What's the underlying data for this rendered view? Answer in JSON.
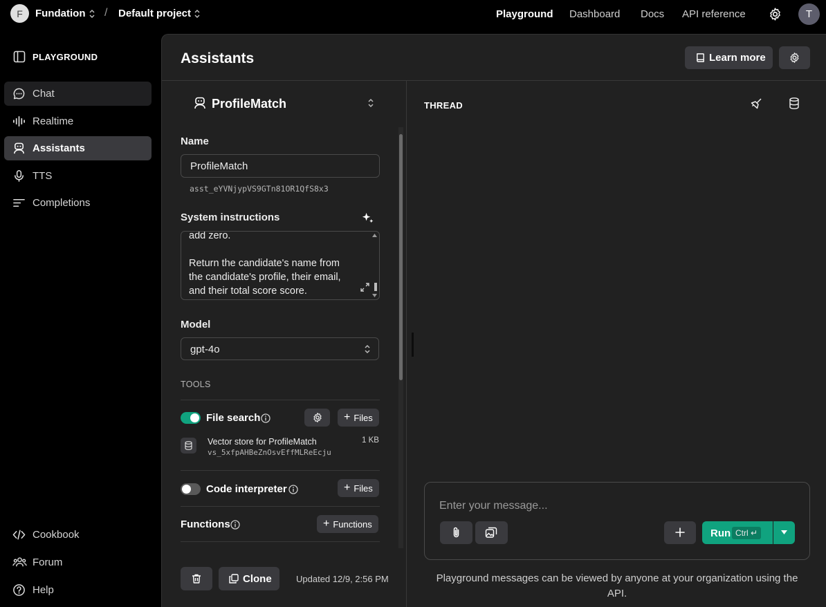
{
  "topbar": {
    "org_initial": "F",
    "org_name": "Fundation",
    "separator": "/",
    "project_name": "Default project",
    "nav": [
      {
        "label": "Playground",
        "active": true
      },
      {
        "label": "Dashboard",
        "active": false
      },
      {
        "label": "Docs",
        "active": false
      },
      {
        "label": "API reference",
        "active": false
      }
    ],
    "user_initial": "T"
  },
  "sidebar": {
    "header": "PLAYGROUND",
    "items": [
      {
        "label": "Chat",
        "icon": "chat-bubble-icon"
      },
      {
        "label": "Realtime",
        "icon": "audio-wave-icon"
      },
      {
        "label": "Assistants",
        "icon": "robot-icon",
        "active": true
      },
      {
        "label": "TTS",
        "icon": "microphone-icon"
      },
      {
        "label": "Completions",
        "icon": "text-lines-icon"
      }
    ],
    "footer": [
      {
        "label": "Cookbook",
        "icon": "code-icon"
      },
      {
        "label": "Forum",
        "icon": "people-icon"
      },
      {
        "label": "Help",
        "icon": "help-circle-icon"
      }
    ]
  },
  "main": {
    "title": "Assistants",
    "learn_more": "Learn more"
  },
  "assistant": {
    "selected": "ProfileMatch",
    "name_label": "Name",
    "name_value": "ProfileMatch",
    "id": "asst_eYVNjypVS9GTn81OR1QfS8x3",
    "instructions_label": "System instructions",
    "instructions_text": "add zero.\n\nReturn the candidate's name from the candidate's profile, their email, and their total score score.",
    "model_label": "Model",
    "model_value": "gpt-4o",
    "tools_label": "TOOLS",
    "file_search": {
      "label": "File search",
      "enabled": true,
      "files_button": "Files",
      "vector_store_name": "Vector store for ProfileMatch",
      "vector_store_id": "vs_5xfpAHBeZnOsvEffMLReEcju",
      "size": "1 KB"
    },
    "code_interpreter": {
      "label": "Code interpreter",
      "enabled": false,
      "files_button": "Files"
    },
    "functions": {
      "label": "Functions",
      "button": "Functions"
    },
    "clone_button": "Clone",
    "updated": "Updated 12/9, 2:56 PM"
  },
  "thread": {
    "label": "THREAD",
    "placeholder": "Enter your message...",
    "run_label": "Run",
    "run_shortcut": "Ctrl ↵",
    "notice": "Playground messages can be viewed by anyone at your organization using the API."
  },
  "colors": {
    "accent_green": "#10a37f",
    "panel_bg": "#212121",
    "button_bg": "#3a3a3e"
  }
}
